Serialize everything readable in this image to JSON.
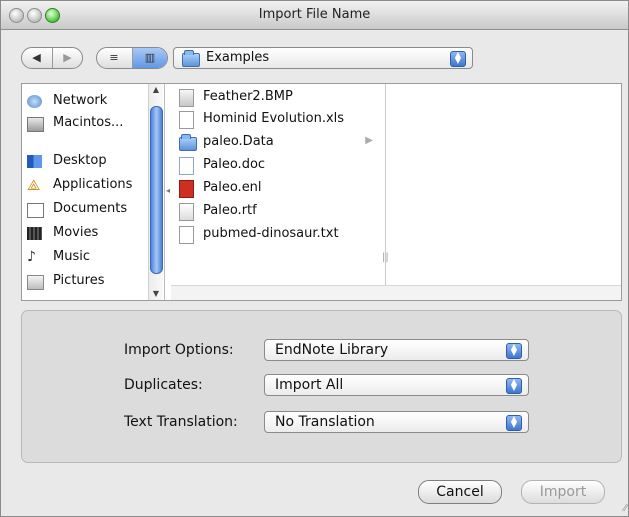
{
  "window": {
    "title": "Import File Name"
  },
  "toolbar": {
    "back_icon": "◀",
    "forward_icon": "▶",
    "list_view_icon": "≡",
    "column_view_icon": "▥",
    "location": "Examples"
  },
  "sidebar": {
    "items": [
      {
        "label": "Network",
        "icon": "network-icon"
      },
      {
        "label": "Macintos...",
        "icon": "hard-drive-icon"
      },
      {
        "label": "Desktop",
        "icon": "desktop-icon"
      },
      {
        "label": "Applications",
        "icon": "applications-icon"
      },
      {
        "label": "Documents",
        "icon": "documents-icon"
      },
      {
        "label": "Movies",
        "icon": "movies-icon"
      },
      {
        "label": "Music",
        "icon": "music-icon"
      },
      {
        "label": "Pictures",
        "icon": "pictures-icon"
      }
    ]
  },
  "files": [
    {
      "name": "Feather2.BMP",
      "icon": "image-file-icon"
    },
    {
      "name": "Hominid Evolution.xls",
      "icon": "document-file-icon"
    },
    {
      "name": "paleo.Data",
      "icon": "folder-icon"
    },
    {
      "name": "Paleo.doc",
      "icon": "word-document-icon"
    },
    {
      "name": "Paleo.enl",
      "icon": "endnote-library-icon"
    },
    {
      "name": "Paleo.rtf",
      "icon": "rtf-document-icon"
    },
    {
      "name": "pubmed-dinosaur.txt",
      "icon": "text-file-icon"
    }
  ],
  "options": {
    "import_label": "Import Options:",
    "import_value": "EndNote Library",
    "duplicates_label": "Duplicates:",
    "duplicates_value": "Import All",
    "translation_label": "Text Translation:",
    "translation_value": "No Translation"
  },
  "buttons": {
    "cancel": "Cancel",
    "import": "Import"
  },
  "colors": {
    "accent": "#4c84df"
  }
}
